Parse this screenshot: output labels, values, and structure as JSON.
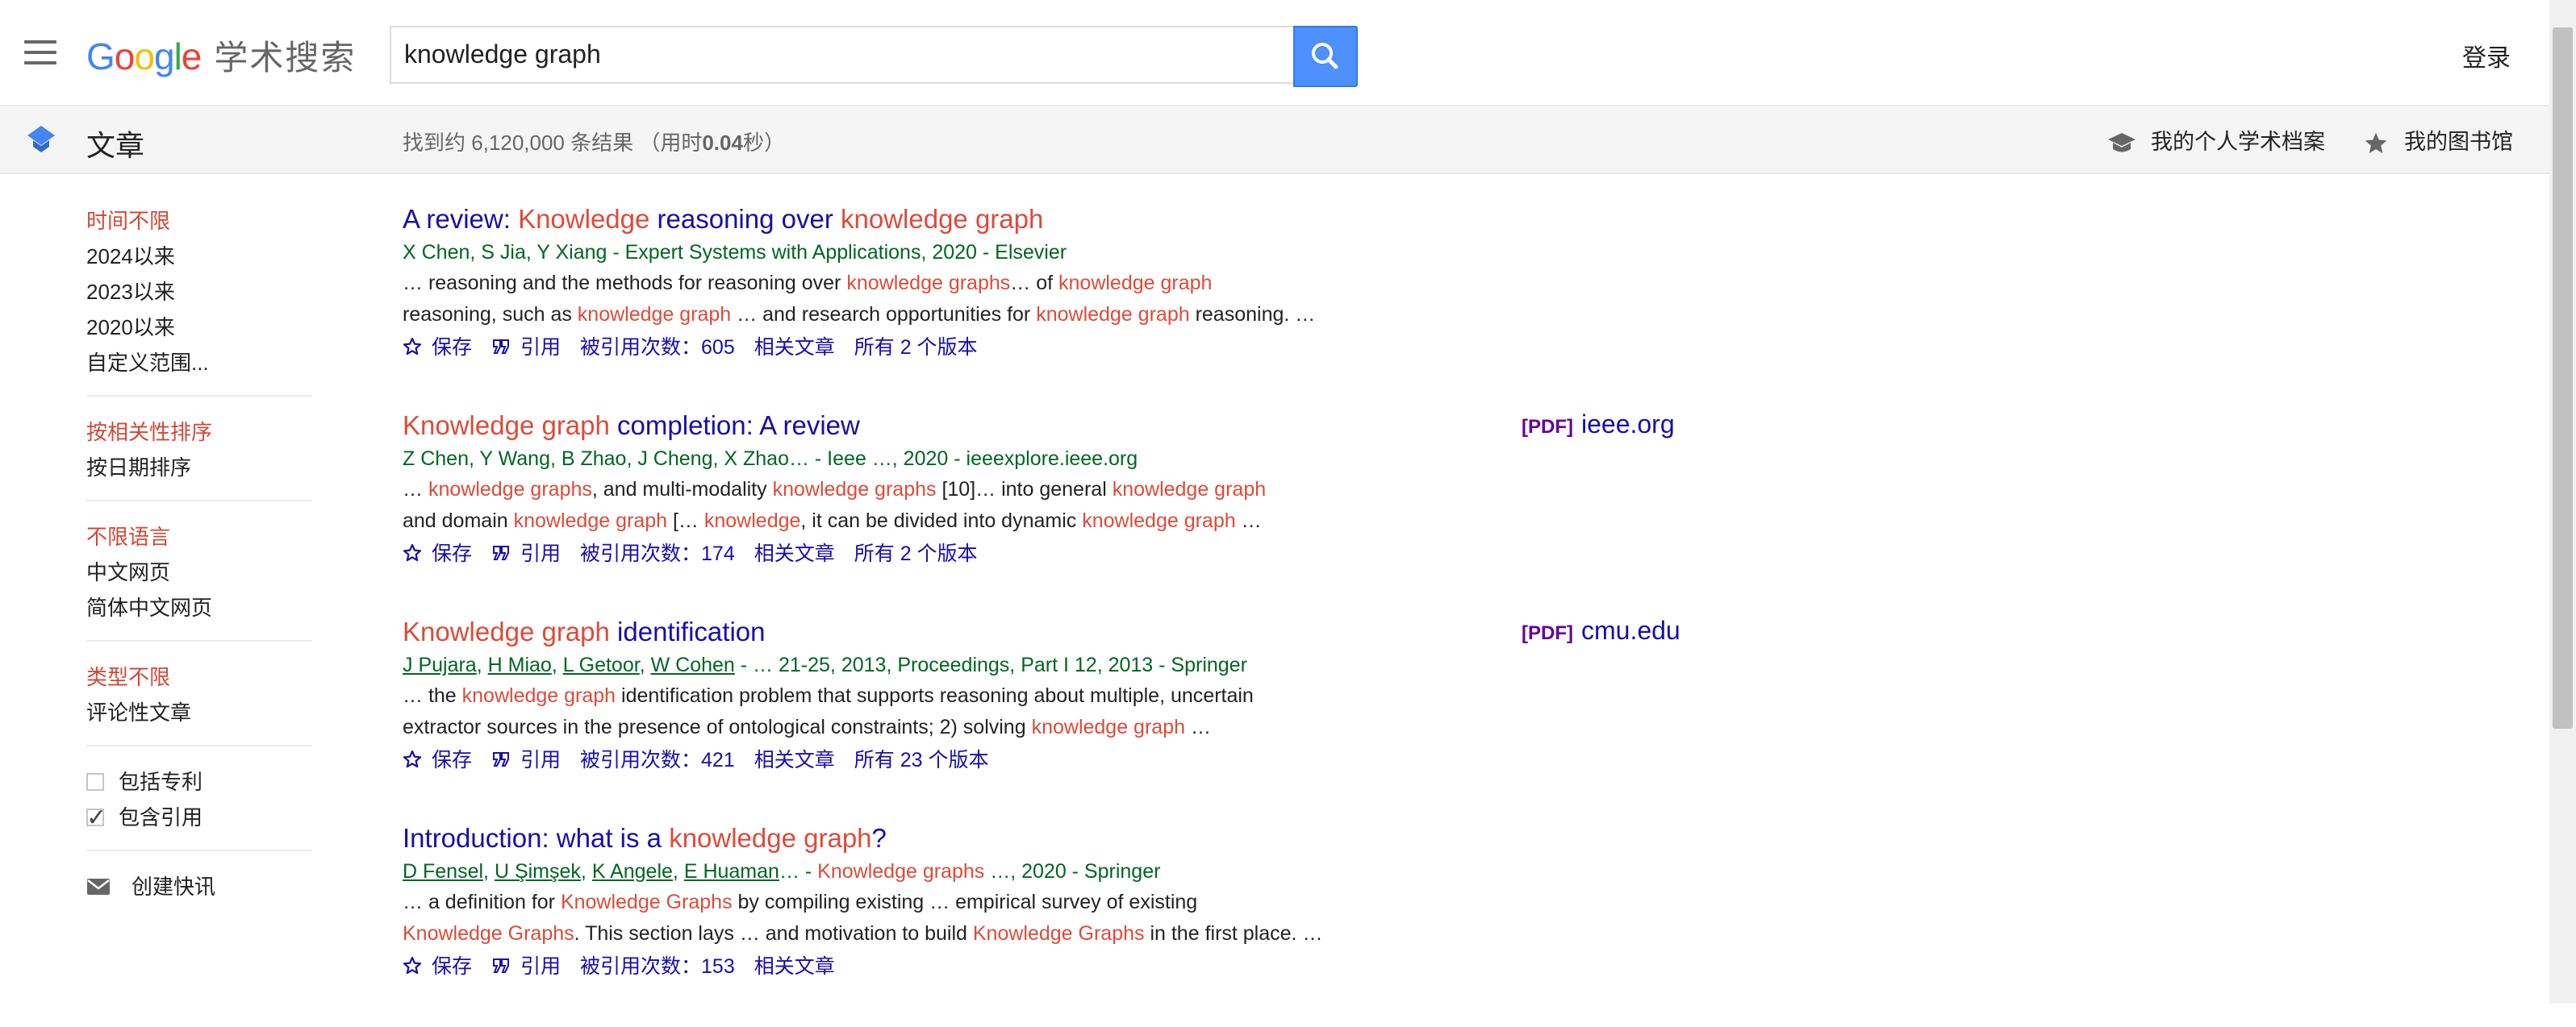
{
  "header": {
    "logo_google": "Google",
    "logo_product": "学术搜索",
    "search_value": "knowledge graph",
    "login_label": "登录"
  },
  "subheader": {
    "section_title": "文章",
    "stats_prefix": "找到约 6,120,000 条结果  （用时",
    "stats_time": "0.04",
    "stats_suffix": "秒）",
    "profile_label": "我的个人学术档案",
    "library_label": "我的图书馆"
  },
  "sidebar": {
    "time_filters": [
      {
        "label": "时间不限",
        "active": true
      },
      {
        "label": "2024以来",
        "active": false
      },
      {
        "label": "2023以来",
        "active": false
      },
      {
        "label": "2020以来",
        "active": false
      },
      {
        "label": "自定义范围...",
        "active": false
      }
    ],
    "sort_options": [
      {
        "label": "按相关性排序",
        "active": true
      },
      {
        "label": "按日期排序",
        "active": false
      }
    ],
    "language_options": [
      {
        "label": "不限语言",
        "active": true
      },
      {
        "label": "中文网页",
        "active": false
      },
      {
        "label": "简体中文网页",
        "active": false
      }
    ],
    "type_options": [
      {
        "label": "类型不限",
        "active": true
      },
      {
        "label": "评论性文章",
        "active": false
      }
    ],
    "include_patents": {
      "label": "包括专利",
      "checked": false
    },
    "include_citations": {
      "label": "包含引用",
      "checked": true
    },
    "create_alert": "创建快讯"
  },
  "actions": {
    "save": "保存",
    "cite": "引用",
    "related": "相关文章"
  },
  "results": [
    {
      "title_parts": [
        {
          "t": "A review: ",
          "hl": false
        },
        {
          "t": "Knowledge",
          "hl": true
        },
        {
          "t": " reasoning over ",
          "hl": false
        },
        {
          "t": "knowledge graph",
          "hl": true
        }
      ],
      "authors_parts": [
        {
          "t": "X Chen, S Jia, Y Xiang - Expert Systems with Applications, 2020 - Elsevier",
          "link": false
        }
      ],
      "snippet_lines": [
        [
          {
            "t": "… reasoning and the methods for reasoning over ",
            "hl": false
          },
          {
            "t": "knowledge graphs",
            "hl": true
          },
          {
            "t": "… of ",
            "hl": false
          },
          {
            "t": "knowledge graph",
            "hl": true
          }
        ],
        [
          {
            "t": "reasoning, such as ",
            "hl": false
          },
          {
            "t": "knowledge graph",
            "hl": true
          },
          {
            "t": " … and research opportunities for ",
            "hl": false
          },
          {
            "t": "knowledge graph",
            "hl": true
          },
          {
            "t": " reasoning. …",
            "hl": false
          }
        ]
      ],
      "cited_by": "被引用次数：605",
      "versions": "所有 2 个版本",
      "pdf": null
    },
    {
      "title_parts": [
        {
          "t": "Knowledge graph",
          "hl": true
        },
        {
          "t": " completion: A review",
          "hl": false
        }
      ],
      "authors_parts": [
        {
          "t": "Z Chen, Y Wang, B Zhao, J Cheng, X Zhao… - Ieee …, 2020 - ieeexplore.ieee.org",
          "link": false
        }
      ],
      "snippet_lines": [
        [
          {
            "t": "… ",
            "hl": false
          },
          {
            "t": "knowledge graphs",
            "hl": true
          },
          {
            "t": ", and multi-modality ",
            "hl": false
          },
          {
            "t": "knowledge graphs",
            "hl": true
          },
          {
            "t": " [10]… into general ",
            "hl": false
          },
          {
            "t": "knowledge graph",
            "hl": true
          }
        ],
        [
          {
            "t": "and domain ",
            "hl": false
          },
          {
            "t": "knowledge graph",
            "hl": true
          },
          {
            "t": " [… ",
            "hl": false
          },
          {
            "t": "knowledge",
            "hl": true
          },
          {
            "t": ", it can be divided into dynamic ",
            "hl": false
          },
          {
            "t": "knowledge graph",
            "hl": true
          },
          {
            "t": " …",
            "hl": false
          }
        ]
      ],
      "cited_by": "被引用次数：174",
      "versions": "所有 2 个版本",
      "pdf": {
        "tag": "[PDF]",
        "source": "ieee.org"
      }
    },
    {
      "title_parts": [
        {
          "t": "Knowledge graph",
          "hl": true
        },
        {
          "t": " identification",
          "hl": false
        }
      ],
      "authors_parts": [
        {
          "t": "J Pujara",
          "link": true
        },
        {
          "t": ", ",
          "link": false
        },
        {
          "t": "H Miao",
          "link": true
        },
        {
          "t": ", ",
          "link": false
        },
        {
          "t": "L Getoor",
          "link": true
        },
        {
          "t": ", ",
          "link": false
        },
        {
          "t": "W Cohen",
          "link": true
        },
        {
          "t": " - … 21-25, 2013, Proceedings, Part I 12, 2013 - Springer",
          "link": false
        }
      ],
      "snippet_lines": [
        [
          {
            "t": "… the ",
            "hl": false
          },
          {
            "t": "knowledge graph",
            "hl": true
          },
          {
            "t": " identification problem that supports reasoning about multiple, uncertain",
            "hl": false
          }
        ],
        [
          {
            "t": "extractor sources in the presence of ontological constraints; 2) solving ",
            "hl": false
          },
          {
            "t": "knowledge graph",
            "hl": true
          },
          {
            "t": " …",
            "hl": false
          }
        ]
      ],
      "cited_by": "被引用次数：421",
      "versions": "所有 23 个版本",
      "pdf": {
        "tag": "[PDF]",
        "source": "cmu.edu"
      }
    },
    {
      "title_parts": [
        {
          "t": "Introduction: what is a ",
          "hl": false
        },
        {
          "t": "knowledge graph",
          "hl": true
        },
        {
          "t": "?",
          "hl": false
        }
      ],
      "authors_parts": [
        {
          "t": "D Fensel",
          "link": true
        },
        {
          "t": ", ",
          "link": false
        },
        {
          "t": "U Şimşek",
          "link": true
        },
        {
          "t": ", ",
          "link": false
        },
        {
          "t": "K Angele",
          "link": true
        },
        {
          "t": ", ",
          "link": false
        },
        {
          "t": "E Huaman",
          "link": true
        },
        {
          "t": "… - ",
          "link": false
        },
        {
          "t": "Knowledge graphs",
          "link": false,
          "hl": true
        },
        {
          "t": " …, 2020 - Springer",
          "link": false
        }
      ],
      "snippet_lines": [
        [
          {
            "t": "… a definition for ",
            "hl": false
          },
          {
            "t": "Knowledge Graphs",
            "hl": true
          },
          {
            "t": " by compiling existing … empirical survey of existing",
            "hl": false
          }
        ],
        [
          {
            "t": "Knowledge Graphs",
            "hl": true
          },
          {
            "t": ". This section lays … and motivation to build ",
            "hl": false
          },
          {
            "t": "Knowledge Graphs",
            "hl": true
          },
          {
            "t": " in the first place. …",
            "hl": false
          }
        ]
      ],
      "cited_by": "被引用次数：153",
      "versions": null,
      "pdf": null
    }
  ],
  "colors": {
    "link_blue": "#1a0dab",
    "highlight_red": "#dd4b39",
    "author_green": "#006621",
    "search_button_blue": "#4d90fe",
    "pdf_purple": "#660099"
  },
  "icons": [
    "menu-icon",
    "search-icon",
    "graduation-cap-icon",
    "star-icon",
    "quote-icon",
    "envelope-icon"
  ]
}
